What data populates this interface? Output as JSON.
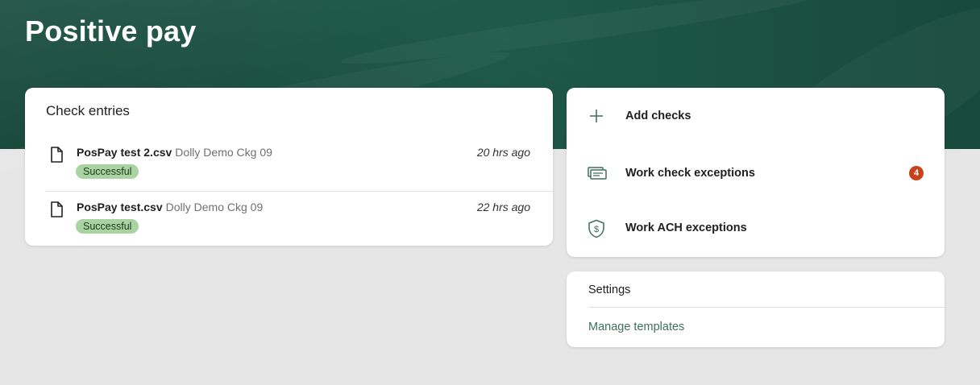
{
  "header": {
    "title": "Positive pay"
  },
  "check_entries": {
    "title": "Check entries",
    "items": [
      {
        "file_name": "PosPay test 2.csv",
        "account": "Dolly Demo Ckg 09",
        "status": "Successful",
        "time": "20 hrs ago"
      },
      {
        "file_name": "PosPay test.csv",
        "account": "Dolly Demo Ckg 09",
        "status": "Successful",
        "time": "22 hrs ago"
      }
    ]
  },
  "actions": {
    "add_checks": {
      "label": "Add checks",
      "icon": "plus-icon"
    },
    "work_check_exceptions": {
      "label": "Work check exceptions",
      "icon": "checks-icon",
      "badge": "4"
    },
    "work_ach_exceptions": {
      "label": "Work ACH exceptions",
      "icon": "shield-dollar-icon"
    }
  },
  "settings": {
    "title": "Settings",
    "manage_templates": "Manage templates"
  },
  "colors": {
    "header_green": "#1f5a48",
    "status_success": "#a9d3a1",
    "badge_red": "#c8421c",
    "link_green": "#3f6f5b"
  }
}
